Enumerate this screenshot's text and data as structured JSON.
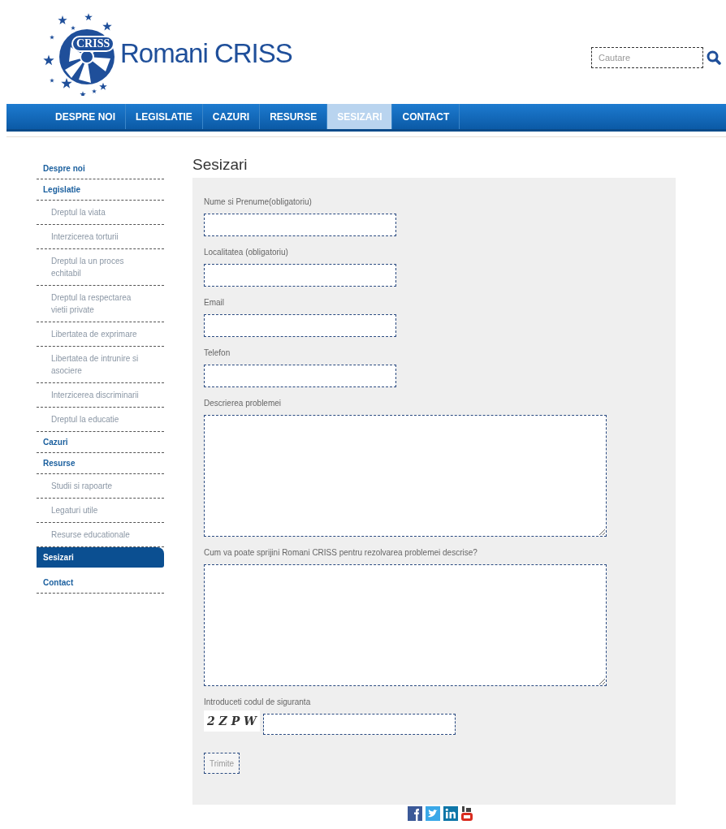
{
  "logo": {
    "badge": "CRISS",
    "name": "Romani CRISS"
  },
  "search": {
    "placeholder": "Cautare"
  },
  "nav": [
    {
      "label": "DESPRE NOI",
      "selected": false
    },
    {
      "label": "LEGISLATIE",
      "selected": false
    },
    {
      "label": "CAZURI",
      "selected": false
    },
    {
      "label": "RESURSE",
      "selected": false
    },
    {
      "label": "SESIZARI",
      "selected": true
    },
    {
      "label": "CONTACT",
      "selected": false
    }
  ],
  "sidebar": {
    "items": [
      {
        "label": "Despre noi",
        "selected": false
      },
      {
        "label": "Legislatie",
        "selected": false,
        "children": [
          {
            "label": "Dreptul la viata"
          },
          {
            "label": "Interzicerea torturii"
          },
          {
            "label": "Dreptul la un proces echitabil"
          },
          {
            "label": "Dreptul la respectarea vietii private"
          },
          {
            "label": "Libertatea de exprimare"
          },
          {
            "label": "Libertatea de intrunire si asociere"
          },
          {
            "label": "Interzicerea discriminarii"
          },
          {
            "label": "Dreptul la educatie"
          }
        ]
      },
      {
        "label": "Cazuri",
        "selected": false
      },
      {
        "label": "Resurse",
        "selected": false,
        "children": [
          {
            "label": "Studii si rapoarte"
          },
          {
            "label": "Legaturi utile"
          },
          {
            "label": "Resurse educationale"
          }
        ]
      },
      {
        "label": "Sesizari",
        "selected": true
      },
      {
        "label": "Contact",
        "selected": false
      }
    ]
  },
  "page_title": "Sesizari",
  "form": {
    "fields": [
      {
        "kind": "input",
        "label": "Nume si Prenume(obligatoriu)"
      },
      {
        "kind": "input",
        "label": "Localitatea (obligatoriu)"
      },
      {
        "kind": "input",
        "label": "Email"
      },
      {
        "kind": "input",
        "label": "Telefon"
      },
      {
        "kind": "textarea",
        "label": "Descrierea problemei"
      },
      {
        "kind": "textarea",
        "label": "Cum va poate sprijini Romani CRISS pentru rezolvarea problemei descrise?"
      },
      {
        "kind": "captcha",
        "label": "Introduceti codul de siguranta",
        "code": "2 Z P W"
      }
    ],
    "submit": "Trimite"
  }
}
